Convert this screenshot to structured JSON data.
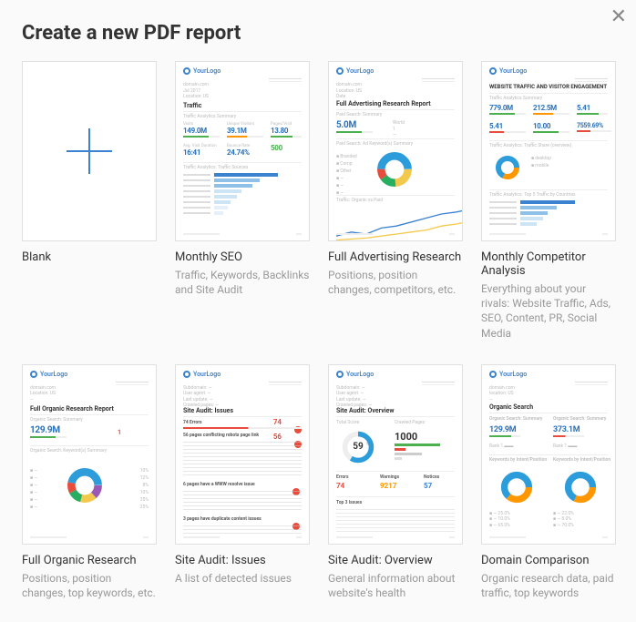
{
  "title": "Create a new PDF report",
  "logo_text": "YourLogo",
  "cards": [
    {
      "title": "Blank",
      "desc": ""
    },
    {
      "title": "Monthly SEO",
      "desc": "Traffic, Keywords, Backlinks and Site Audit"
    },
    {
      "title": "Full Advertising Research",
      "desc": "Positions, position changes, competitors, etc."
    },
    {
      "title": "Monthly Competitor Analysis",
      "desc": "Everything about your rivals: Website Traffic, Ads, SEO, Content, PR, Social Media"
    },
    {
      "title": "Full Organic Research",
      "desc": "Positions, position changes, top keywords, etc."
    },
    {
      "title": "Site Audit: Issues",
      "desc": "A list of detected issues"
    },
    {
      "title": "Site Audit: Overview",
      "desc": "General information about website's health"
    },
    {
      "title": "Domain Comparison",
      "desc": "Organic research data, paid traffic, top keywords"
    }
  ],
  "thumbs": {
    "monthly_seo": {
      "h1": "Traffic",
      "sub1": "Traffic Analytics Summary",
      "stats": [
        {
          "lbl": "Visits",
          "num": "149.0M",
          "bar": "green"
        },
        {
          "lbl": "Unique Visitors",
          "num": "39.1M",
          "bar": "orange"
        },
        {
          "lbl": "Pages/Visit",
          "num": "13.80",
          "bar": "green"
        }
      ],
      "stats2": [
        {
          "lbl": "Avg. Visit Duration",
          "num": "16:41"
        },
        {
          "lbl": "Bounce Rate",
          "num": "24.74%"
        },
        {
          "lbl": "",
          "num": ""
        }
      ],
      "sub2": "Traffic Analytics: Traffic Sources"
    },
    "full_ads": {
      "h1": "Full Advertising Research Report",
      "sub1": "Paid Search: Summary",
      "big": "5.0M",
      "sub2": "Paid Search: Ad Keyword(s) Summary"
    },
    "competitor": {
      "h1": "WEBSITE TRAFFIC AND VISITOR ENGAGEMENT",
      "sub1": "Traffic Analytics Summary",
      "stats": [
        {
          "num": "779.0M",
          "bar": "green"
        },
        {
          "num": "212.5M",
          "bar": "orange"
        },
        {
          "num": "5.41",
          "bar": "green"
        }
      ],
      "stats2": [
        {
          "num": "5.41",
          "bar": "red"
        },
        {
          "num": "10.00",
          "bar": "green"
        },
        {
          "num": "7559.69%",
          "bar": "red"
        }
      ],
      "sub2": "Traffic Analytics: Traffic Share (overview)",
      "sub3": "Traffic Analytics: Top 5 Traffic by Countries"
    },
    "organic": {
      "h1": "Full Organic Research Report",
      "sub1": "Organic Search: Summary",
      "big": "129.9M",
      "sub2": "Organic Search: Keyword(s) Summary"
    },
    "issues": {
      "h1": "Site Audit: Issues",
      "v1": "74",
      "v2": "56"
    },
    "overview": {
      "h1": "Site Audit: Overview",
      "score_label": "Total Score",
      "score": "59",
      "pages_label": "Crawled Pages",
      "pages": "1000",
      "v_err": "74",
      "v_warn": "9217",
      "v_not": "57"
    },
    "domain": {
      "h1": "Organic Search",
      "a": "129.9M",
      "b": "373.1M"
    }
  }
}
